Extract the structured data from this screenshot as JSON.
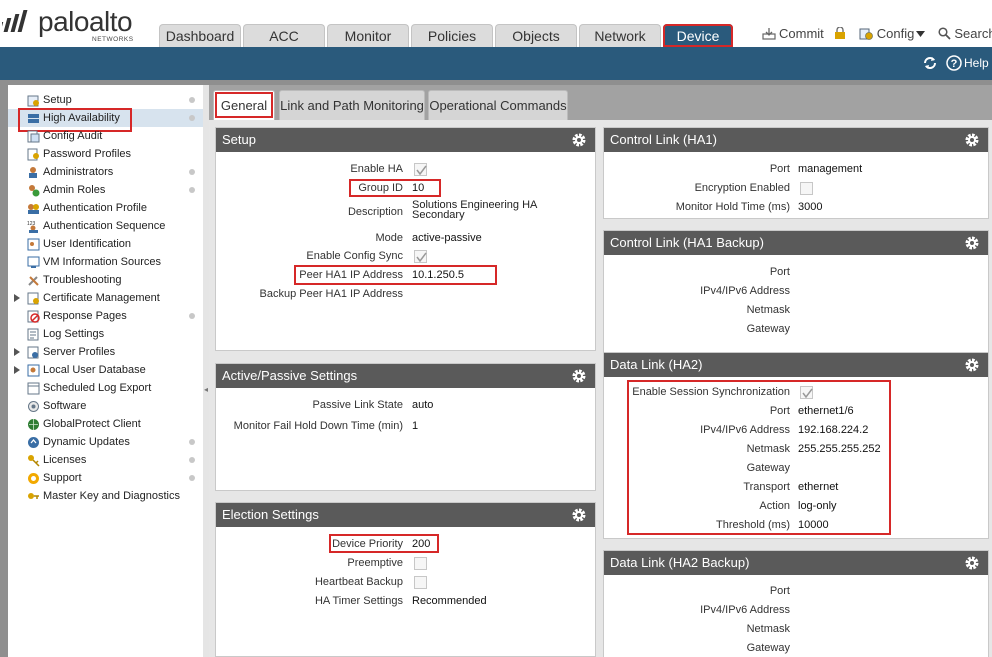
{
  "brand": {
    "name": "paloalto",
    "sub": "NETWORKS"
  },
  "main_tabs": [
    "Dashboard",
    "ACC",
    "Monitor",
    "Policies",
    "Objects",
    "Network",
    "Device"
  ],
  "top_actions": {
    "commit": "Commit",
    "config": "Config",
    "search": "Search"
  },
  "help": "Help",
  "sidebar": {
    "items": [
      {
        "label": "Setup"
      },
      {
        "label": "High Availability"
      },
      {
        "label": "Config Audit"
      },
      {
        "label": "Password Profiles"
      },
      {
        "label": "Administrators"
      },
      {
        "label": "Admin Roles"
      },
      {
        "label": "Authentication Profile"
      },
      {
        "label": "Authentication Sequence"
      },
      {
        "label": "User Identification"
      },
      {
        "label": "VM Information Sources"
      },
      {
        "label": "Troubleshooting"
      },
      {
        "label": "Certificate Management"
      },
      {
        "label": "Response Pages"
      },
      {
        "label": "Log Settings"
      },
      {
        "label": "Server Profiles"
      },
      {
        "label": "Local User Database"
      },
      {
        "label": "Scheduled Log Export"
      },
      {
        "label": "Software"
      },
      {
        "label": "GlobalProtect Client"
      },
      {
        "label": "Dynamic Updates"
      },
      {
        "label": "Licenses"
      },
      {
        "label": "Support"
      },
      {
        "label": "Master Key and Diagnostics"
      }
    ]
  },
  "sub_tabs": [
    "General",
    "Link and Path Monitoring",
    "Operational Commands"
  ],
  "setup": {
    "title": "Setup",
    "enable_ha": "Enable HA",
    "group_id_label": "Group ID",
    "group_id": "10",
    "description_label": "Description",
    "description_1": "Solutions Engineering HA",
    "description_2": "Secondary",
    "mode_label": "Mode",
    "mode": "active-passive",
    "config_sync_label": "Enable Config Sync",
    "peer_ip_label": "Peer HA1 IP Address",
    "peer_ip": "10.1.250.5",
    "backup_peer_label": "Backup Peer HA1 IP Address"
  },
  "active_passive": {
    "title": "Active/Passive Settings",
    "link_state_label": "Passive Link State",
    "link_state": "auto",
    "monitor_label": "Monitor Fail Hold Down Time (min)",
    "monitor": "1"
  },
  "election": {
    "title": "Election Settings",
    "priority_label": "Device Priority",
    "priority": "200",
    "preemptive_label": "Preemptive",
    "heartbeat_label": "Heartbeat Backup",
    "timer_label": "HA Timer Settings",
    "timer": "Recommended"
  },
  "ha1": {
    "title": "Control Link (HA1)",
    "port_label": "Port",
    "port": "management",
    "enc_label": "Encryption Enabled",
    "hold_label": "Monitor Hold Time (ms)",
    "hold": "3000"
  },
  "ha1b": {
    "title": "Control Link (HA1 Backup)",
    "port_label": "Port",
    "ip_label": "IPv4/IPv6 Address",
    "mask_label": "Netmask",
    "gw_label": "Gateway"
  },
  "ha2": {
    "title": "Data Link (HA2)",
    "sync_label": "Enable Session Synchronization",
    "port_label": "Port",
    "port": "ethernet1/6",
    "ip_label": "IPv4/IPv6 Address",
    "ip": "192.168.224.2",
    "mask_label": "Netmask",
    "mask": "255.255.255.252",
    "gw_label": "Gateway",
    "transport_label": "Transport",
    "transport": "ethernet",
    "action_label": "Action",
    "action": "log-only",
    "threshold_label": "Threshold (ms)",
    "threshold": "10000"
  },
  "ha2b": {
    "title": "Data Link (HA2 Backup)",
    "port_label": "Port",
    "ip_label": "IPv4/IPv6 Address",
    "mask_label": "Netmask",
    "gw_label": "Gateway"
  }
}
